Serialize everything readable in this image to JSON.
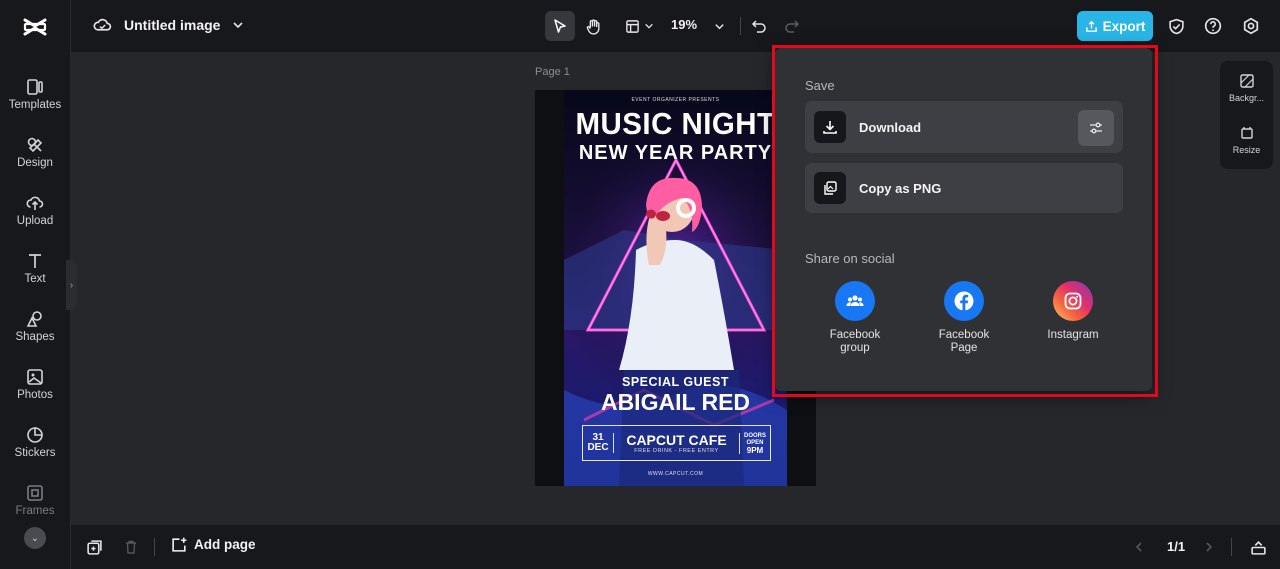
{
  "sidebar": {
    "items": [
      {
        "label": "Templates",
        "icon": "templates-icon"
      },
      {
        "label": "Design",
        "icon": "design-icon"
      },
      {
        "label": "Upload",
        "icon": "upload-icon"
      },
      {
        "label": "Text",
        "icon": "text-icon"
      },
      {
        "label": "Shapes",
        "icon": "shapes-icon"
      },
      {
        "label": "Photos",
        "icon": "photos-icon"
      },
      {
        "label": "Stickers",
        "icon": "stickers-icon"
      },
      {
        "label": "Frames",
        "icon": "frames-icon"
      }
    ]
  },
  "header": {
    "title": "Untitled image",
    "zoom": "19%",
    "export_label": "Export"
  },
  "canvas": {
    "page_label": "Page 1",
    "poster": {
      "organizer": "EVENT ORGANIZER PRESENTS",
      "title1": "MUSIC NIGHT",
      "title2": "NEW YEAR PARTY",
      "guest_label": "SPECIAL GUEST",
      "guest_name": "ABIGAIL RED",
      "date_day": "31",
      "date_month": "DEC",
      "venue": "CAPCUT CAFE",
      "venue_sub": "FREE DRINK - FREE ENTRY",
      "doors1": "DOORS",
      "doors2": "OPEN",
      "doors3": "9PM",
      "website": "WWW.CAPCUT.COM"
    }
  },
  "right_panel": {
    "background_label": "Backgr...",
    "resize_label": "Resize"
  },
  "export_panel": {
    "save_label": "Save",
    "download_label": "Download",
    "copy_label": "Copy as PNG",
    "share_label": "Share on social",
    "social": [
      {
        "line1": "Facebook",
        "line2": "group",
        "color": "#1877f2"
      },
      {
        "line1": "Facebook",
        "line2": "Page",
        "color": "#1877f2"
      },
      {
        "line1": "Instagram",
        "line2": "",
        "color": "#e1306c"
      }
    ]
  },
  "bottom": {
    "add_page_label": "Add page",
    "pager": "1/1"
  },
  "colors": {
    "accent": "#29b6e6",
    "highlight": "#e3091b"
  }
}
